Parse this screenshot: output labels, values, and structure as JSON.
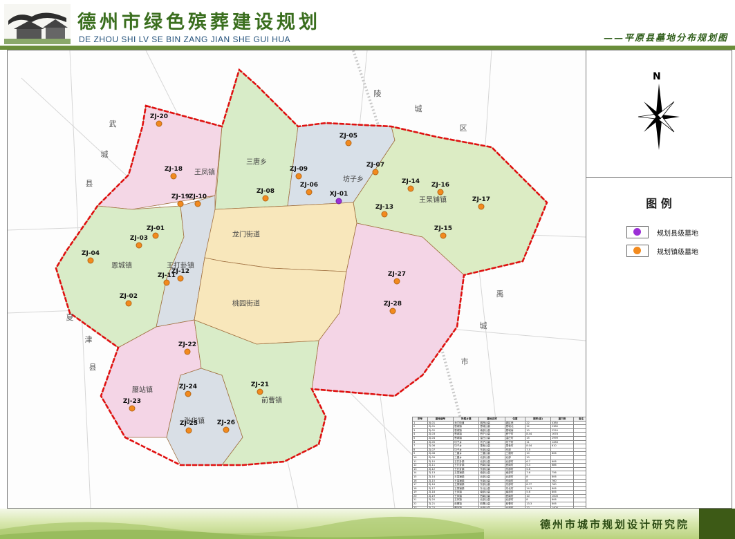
{
  "header": {
    "title_cn": "德州市绿色殡葬建设规划",
    "title_en": "DE ZHOU SHI LV SE BIN ZANG JIAN SHE GUI HUA",
    "subtitle": "——平原县墓地分布规划图"
  },
  "compass": {
    "label": "N"
  },
  "legend": {
    "title": "图 例",
    "items": [
      {
        "label": "规划县级墓地",
        "color": "#9b2fd6"
      },
      {
        "label": "规划镇级墓地",
        "color": "#f28a1e"
      }
    ]
  },
  "footer": {
    "org": "德州市城市规划设计研究院"
  },
  "map": {
    "county_labels": [
      "武",
      "城",
      "县",
      "陵",
      "城",
      "区",
      "夏",
      "津",
      "县",
      "禹",
      "城",
      "市"
    ],
    "town_labels": [
      "王凤镇",
      "三唐乡",
      "坊子乡",
      "王杲铺镇",
      "龙门街道",
      "恩城镇",
      "王打卦镇",
      "桃园街道",
      "腰站镇",
      "张华镇",
      "前曹镇"
    ],
    "cemeteries": [
      {
        "id": "XJ-01",
        "level": "county"
      },
      {
        "id": "ZJ-01",
        "level": "town"
      },
      {
        "id": "ZJ-02",
        "level": "town"
      },
      {
        "id": "ZJ-03",
        "level": "town"
      },
      {
        "id": "ZJ-04",
        "level": "town"
      },
      {
        "id": "ZJ-05",
        "level": "town"
      },
      {
        "id": "ZJ-06",
        "level": "town"
      },
      {
        "id": "ZJ-07",
        "level": "town"
      },
      {
        "id": "ZJ-08",
        "level": "town"
      },
      {
        "id": "ZJ-09",
        "level": "town"
      },
      {
        "id": "ZJ-10",
        "level": "town"
      },
      {
        "id": "ZJ-11",
        "level": "town"
      },
      {
        "id": "ZJ-12",
        "level": "town"
      },
      {
        "id": "ZJ-13",
        "level": "town"
      },
      {
        "id": "ZJ-14",
        "level": "town"
      },
      {
        "id": "ZJ-15",
        "level": "town"
      },
      {
        "id": "ZJ-16",
        "level": "town"
      },
      {
        "id": "ZJ-17",
        "level": "town"
      },
      {
        "id": "ZJ-18",
        "level": "town"
      },
      {
        "id": "ZJ-19",
        "level": "town"
      },
      {
        "id": "ZJ-20",
        "level": "town"
      },
      {
        "id": "ZJ-21",
        "level": "town"
      },
      {
        "id": "ZJ-22",
        "level": "town"
      },
      {
        "id": "ZJ-23",
        "level": "town"
      },
      {
        "id": "ZJ-24",
        "level": "town"
      },
      {
        "id": "ZJ-25",
        "level": "town"
      },
      {
        "id": "ZJ-26",
        "level": "town"
      },
      {
        "id": "ZJ-27",
        "level": "town"
      },
      {
        "id": "ZJ-28",
        "level": "town"
      }
    ]
  },
  "table": {
    "headers": [
      "序号",
      "墓地编号",
      "所属乡镇",
      "墓地名称",
      "位置",
      "面积(亩)",
      "墓穴数",
      "备注"
    ],
    "rows": [
      [
        "1",
        "XJ-01",
        "龙门街道",
        "城西公墓",
        "城区西",
        "22",
        "4380",
        ""
      ],
      [
        "2",
        "ZJ-01",
        "恩城镇",
        "恩城公墓",
        "恩城北",
        "12",
        "2380",
        ""
      ],
      [
        "3",
        "ZJ-02",
        "恩城镇",
        "南部公墓",
        "恩城南",
        "10",
        "2220",
        ""
      ],
      [
        "4",
        "ZJ-03",
        "恩城镇",
        "西宁公墓",
        "西宁村",
        "8.44",
        "1678",
        ""
      ],
      [
        "5",
        "ZJ-04",
        "恩城镇",
        "温庄公墓",
        "温庄村",
        "15",
        "2999",
        ""
      ],
      [
        "6",
        "ZJ-05",
        "坊子乡",
        "坊子公墓",
        "坊子村",
        "11",
        "1283",
        ""
      ],
      [
        "7",
        "ZJ-06",
        "坊子乡",
        "里舍公墓",
        "里舍村",
        "8.04",
        "610",
        ""
      ],
      [
        "8",
        "ZJ-07",
        "坊子乡",
        "东部公墓",
        "东部",
        "7.5",
        "",
        ""
      ],
      [
        "9",
        "ZJ-08",
        "三唐乡",
        "三唐公墓",
        "三唐村",
        "10",
        "806",
        ""
      ],
      [
        "10",
        "ZJ-09",
        "三唐乡",
        "北部公墓",
        "北部",
        "10",
        "",
        ""
      ],
      [
        "11",
        "ZJ-10",
        "王打卦镇",
        "北部公墓",
        "北部村",
        "6.7",
        "606",
        ""
      ],
      [
        "12",
        "ZJ-11",
        "王打卦镇",
        "西南公墓",
        "西南村",
        "5.4",
        "686",
        ""
      ],
      [
        "13",
        "ZJ-12",
        "王打卦镇",
        "东部公墓",
        "东部村",
        "5.6",
        "",
        ""
      ],
      [
        "14",
        "ZJ-13",
        "王杲铺镇",
        "南部公墓",
        "南部村",
        "7.6",
        "756",
        ""
      ],
      [
        "15",
        "ZJ-14",
        "王杲铺镇",
        "北部公墓",
        "北部村",
        "8",
        "806",
        ""
      ],
      [
        "16",
        "ZJ-15",
        "王杲铺镇",
        "东南公墓",
        "东南村",
        "8",
        "760",
        ""
      ],
      [
        "17",
        "ZJ-16",
        "王杲铺镇",
        "东部公墓",
        "东部村",
        "8.77",
        "760",
        ""
      ],
      [
        "18",
        "ZJ-17",
        "王杲铺镇",
        "东北公墓",
        "东北村",
        "14.3",
        "806",
        ""
      ],
      [
        "19",
        "ZJ-18",
        "王凤镇",
        "南部公墓",
        "南部村",
        "5.6",
        "806",
        ""
      ],
      [
        "20",
        "ZJ-19",
        "王凤镇",
        "西南公墓",
        "西南村",
        "10",
        "1000",
        ""
      ],
      [
        "21",
        "ZJ-20",
        "王凤镇",
        "北部公墓",
        "北部村",
        "8",
        "806",
        ""
      ],
      [
        "22",
        "ZJ-21",
        "前曹镇",
        "前曹公墓",
        "前曹村",
        "13.3",
        "806",
        ""
      ],
      [
        "23",
        "ZJ-22",
        "腰站镇",
        "北部公墓",
        "北部村",
        "12",
        "1400",
        ""
      ],
      [
        "24",
        "ZJ-23",
        "腰站镇",
        "西南公墓",
        "西南村",
        "7.9",
        "531",
        ""
      ],
      [
        "25",
        "ZJ-24",
        "张华镇",
        "北部公墓",
        "北部村",
        "10",
        "1312",
        ""
      ],
      [
        "26",
        "ZJ-25",
        "张华镇",
        "南部公墓",
        "南部村",
        "7.6",
        "560",
        ""
      ],
      [
        "27",
        "ZJ-26",
        "张华镇",
        "东南公墓",
        "东南村",
        "7",
        "606",
        ""
      ],
      [
        "28",
        "ZJ-27",
        "桃园街道",
        "东部公墓",
        "东部村",
        "6",
        "606",
        ""
      ],
      [
        "29",
        "ZJ-28",
        "桃园街道",
        "南部公墓",
        "南部村",
        "6.1",
        "781",
        ""
      ]
    ],
    "total": [
      "合计",
      "",
      "",
      "",
      "",
      "257.65",
      "35822",
      ""
    ]
  }
}
